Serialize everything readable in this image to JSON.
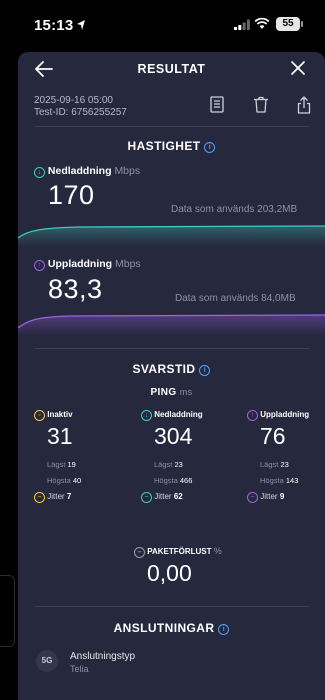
{
  "status_bar": {
    "time": "15:13",
    "battery": "55"
  },
  "header": {
    "title": "RESULTAT"
  },
  "meta": {
    "date": "2025-09-16 05:00",
    "test_id": "Test-ID: 6756255257"
  },
  "hastighet": {
    "title": "HASTIGHET",
    "download": {
      "label": "Nedladdning",
      "unit": "Mbps",
      "value": "170",
      "data_used": "Data som används 203,2MB"
    },
    "upload": {
      "label": "Uppladdning",
      "unit": "Mbps",
      "value": "83,3",
      "data_used": "Data som används 84,0MB"
    }
  },
  "svarstid": {
    "title": "SVARSTID",
    "ping_label": "PING",
    "ping_unit": "ms",
    "columns": [
      {
        "label": "Inaktiv",
        "value": "31",
        "low_label": "Lägst",
        "low": "19",
        "high_label": "Högsta",
        "high": "40",
        "jitter_label": "Jitter",
        "jitter": "7"
      },
      {
        "label": "Nedladdning",
        "value": "304",
        "low_label": "Lägst",
        "low": "23",
        "high_label": "Högsta",
        "high": "466",
        "jitter_label": "Jitter",
        "jitter": "62"
      },
      {
        "label": "Uppladdning",
        "value": "76",
        "low_label": "Lägst",
        "low": "23",
        "high_label": "Högsta",
        "high": "143",
        "jitter_label": "Jitter",
        "jitter": "9"
      }
    ],
    "packet_loss_label": "PAKETFÖRLUST",
    "packet_loss_unit": "%",
    "packet_loss_value": "0,00"
  },
  "anslutningar": {
    "title": "ANSLUTNINGAR",
    "icon_text": "5G",
    "type_label": "Anslutningstyp",
    "type_value": "Telia"
  },
  "colors": {
    "background": "#26283e",
    "download": "#3ecbc0",
    "upload": "#a060e8",
    "idle": "#f5c542",
    "info": "#4fa0ff"
  }
}
